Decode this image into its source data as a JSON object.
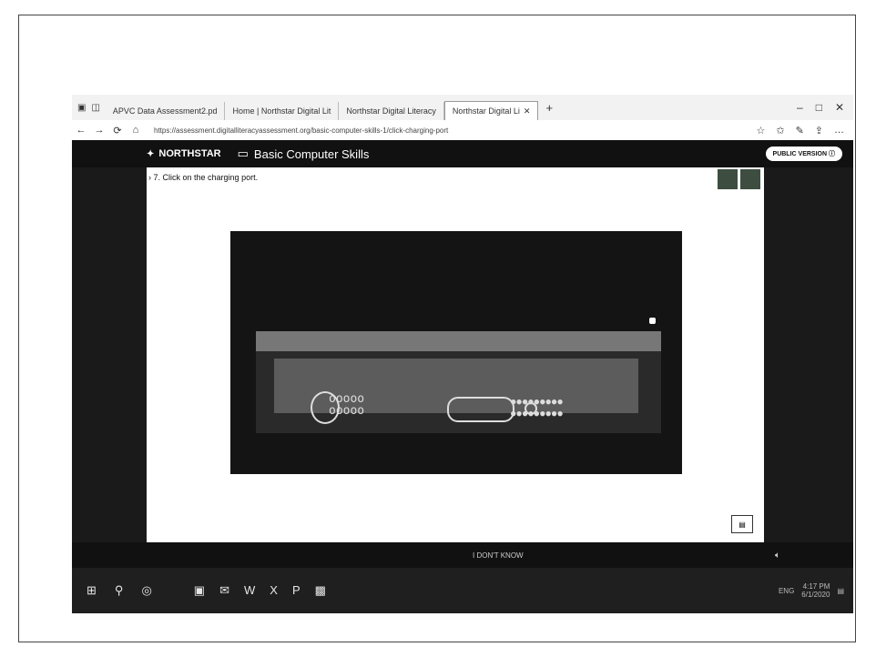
{
  "browser": {
    "tabs": [
      {
        "label": "APVC Data Assessment2.pd",
        "active": false
      },
      {
        "label": "Home | Northstar Digital Lit",
        "active": false
      },
      {
        "label": "Northstar Digital Literacy",
        "active": false
      },
      {
        "label": "Northstar Digital Li",
        "active": true
      }
    ],
    "new_tab": "+",
    "window_controls": [
      "–",
      "□",
      "✕"
    ],
    "url": "https://assessment.digitalliteracyassessment.org/basic-computer-skills-1/click-charging-port",
    "nav_icons": [
      "←",
      "→",
      "⟳",
      "⌂"
    ],
    "tool_icons": [
      "☆",
      "✩",
      "✎",
      "⇪",
      "…"
    ]
  },
  "app": {
    "logo_text": "NORTHSTAR",
    "title": "Basic Computer Skills",
    "public_badge": "PUBLIC VERSION"
  },
  "question": {
    "text": "7. Click on the charging port."
  },
  "footer": {
    "label": "I DON'T KNOW",
    "volume_icon": "speaker-icon"
  },
  "taskbar": {
    "tray_text": "ENG",
    "time": "4:17 PM",
    "date": "6/1/2020"
  }
}
